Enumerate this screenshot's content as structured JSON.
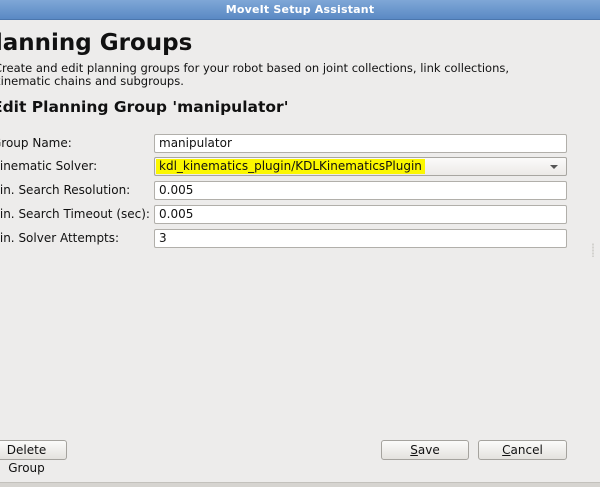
{
  "window": {
    "title": "MoveIt Setup Assistant"
  },
  "page": {
    "title": "Planning Groups",
    "description_line1": "Create and edit planning groups for your robot based on joint collections, link collections,",
    "description_line2": "kinematic chains and subgroups."
  },
  "form": {
    "section_title": "Edit Planning Group 'manipulator'",
    "group_name": {
      "label": "Group Name:",
      "value": "manipulator"
    },
    "kinematic_solver": {
      "label": "Kinematic Solver:",
      "value": "kdl_kinematics_plugin/KDLKinematicsPlugin"
    },
    "search_resolution": {
      "label": "Kin. Search Resolution:",
      "value": "0.005"
    },
    "search_timeout": {
      "label": "Kin. Search Timeout (sec):",
      "value": "0.005"
    },
    "solver_attempts": {
      "label": "Kin. Solver Attempts:",
      "value": "3"
    }
  },
  "buttons": {
    "delete_label": "Delete Group",
    "save_mnemonic": "S",
    "save_rest": "ave",
    "cancel_mnemonic": "C",
    "cancel_rest": "ancel"
  },
  "colors": {
    "titlebar": "#5a89c4",
    "highlight": "#fbf700",
    "background": "#edeceb"
  }
}
